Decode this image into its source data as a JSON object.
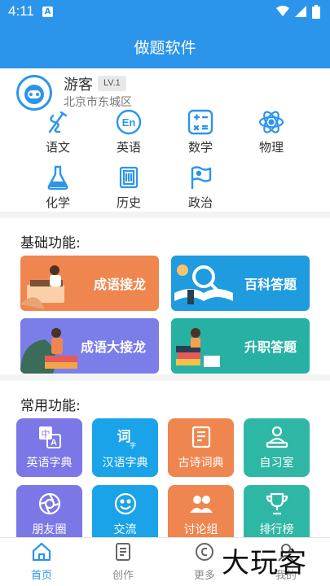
{
  "status_bar": {
    "time": "4:11",
    "notification_letter": "A"
  },
  "header": {
    "title": "做题软件"
  },
  "profile": {
    "name": "游客",
    "level": "LV.1",
    "location": "北京市东城区"
  },
  "subjects": [
    {
      "label": "语文",
      "icon": "pen-icon"
    },
    {
      "label": "英语",
      "icon": "en-icon"
    },
    {
      "label": "数学",
      "icon": "calculator-icon"
    },
    {
      "label": "物理",
      "icon": "atom-icon"
    },
    {
      "label": "化学",
      "icon": "flask-icon"
    },
    {
      "label": "历史",
      "icon": "scroll-icon"
    },
    {
      "label": "政治",
      "icon": "flag-icon"
    }
  ],
  "basic": {
    "title": "基础功能:",
    "cards": [
      {
        "label": "成语接龙",
        "color": "#f0864f"
      },
      {
        "label": "百科答题",
        "color": "#1f9be0"
      },
      {
        "label": "成语大接龙",
        "color": "#7b7ee8"
      },
      {
        "label": "升职答题",
        "color": "#26b1a3"
      }
    ]
  },
  "common": {
    "title": "常用功能:",
    "items": [
      {
        "label": "英语字典",
        "color": "#7b77e6",
        "icon": "translate-icon"
      },
      {
        "label": "汉语字典",
        "color": "#1aa3e8",
        "icon": "dictionary-icon",
        "glyph": "词"
      },
      {
        "label": "古诗词典",
        "color": "#f0864f",
        "icon": "book-icon"
      },
      {
        "label": "自习室",
        "color": "#2fb7a5",
        "icon": "study-icon"
      },
      {
        "label": "朋友圈",
        "color": "#7b77e6",
        "icon": "camera-icon"
      },
      {
        "label": "交流",
        "color": "#1aa3e8",
        "icon": "smile-icon"
      },
      {
        "label": "讨论组",
        "color": "#f0864f",
        "icon": "group-icon"
      },
      {
        "label": "排行榜",
        "color": "#2fb7a5",
        "icon": "trophy-icon"
      }
    ]
  },
  "nav": {
    "items": [
      {
        "label": "首页",
        "icon": "home-icon",
        "active": true
      },
      {
        "label": "创作",
        "icon": "document-icon",
        "active": false
      },
      {
        "label": "更多",
        "icon": "more-icon",
        "active": false
      },
      {
        "label": "我的",
        "icon": "user-icon",
        "active": false
      }
    ]
  },
  "watermark": "大玩客",
  "colors": {
    "primary": "#2b95ec",
    "background": "#f2f3f5"
  }
}
